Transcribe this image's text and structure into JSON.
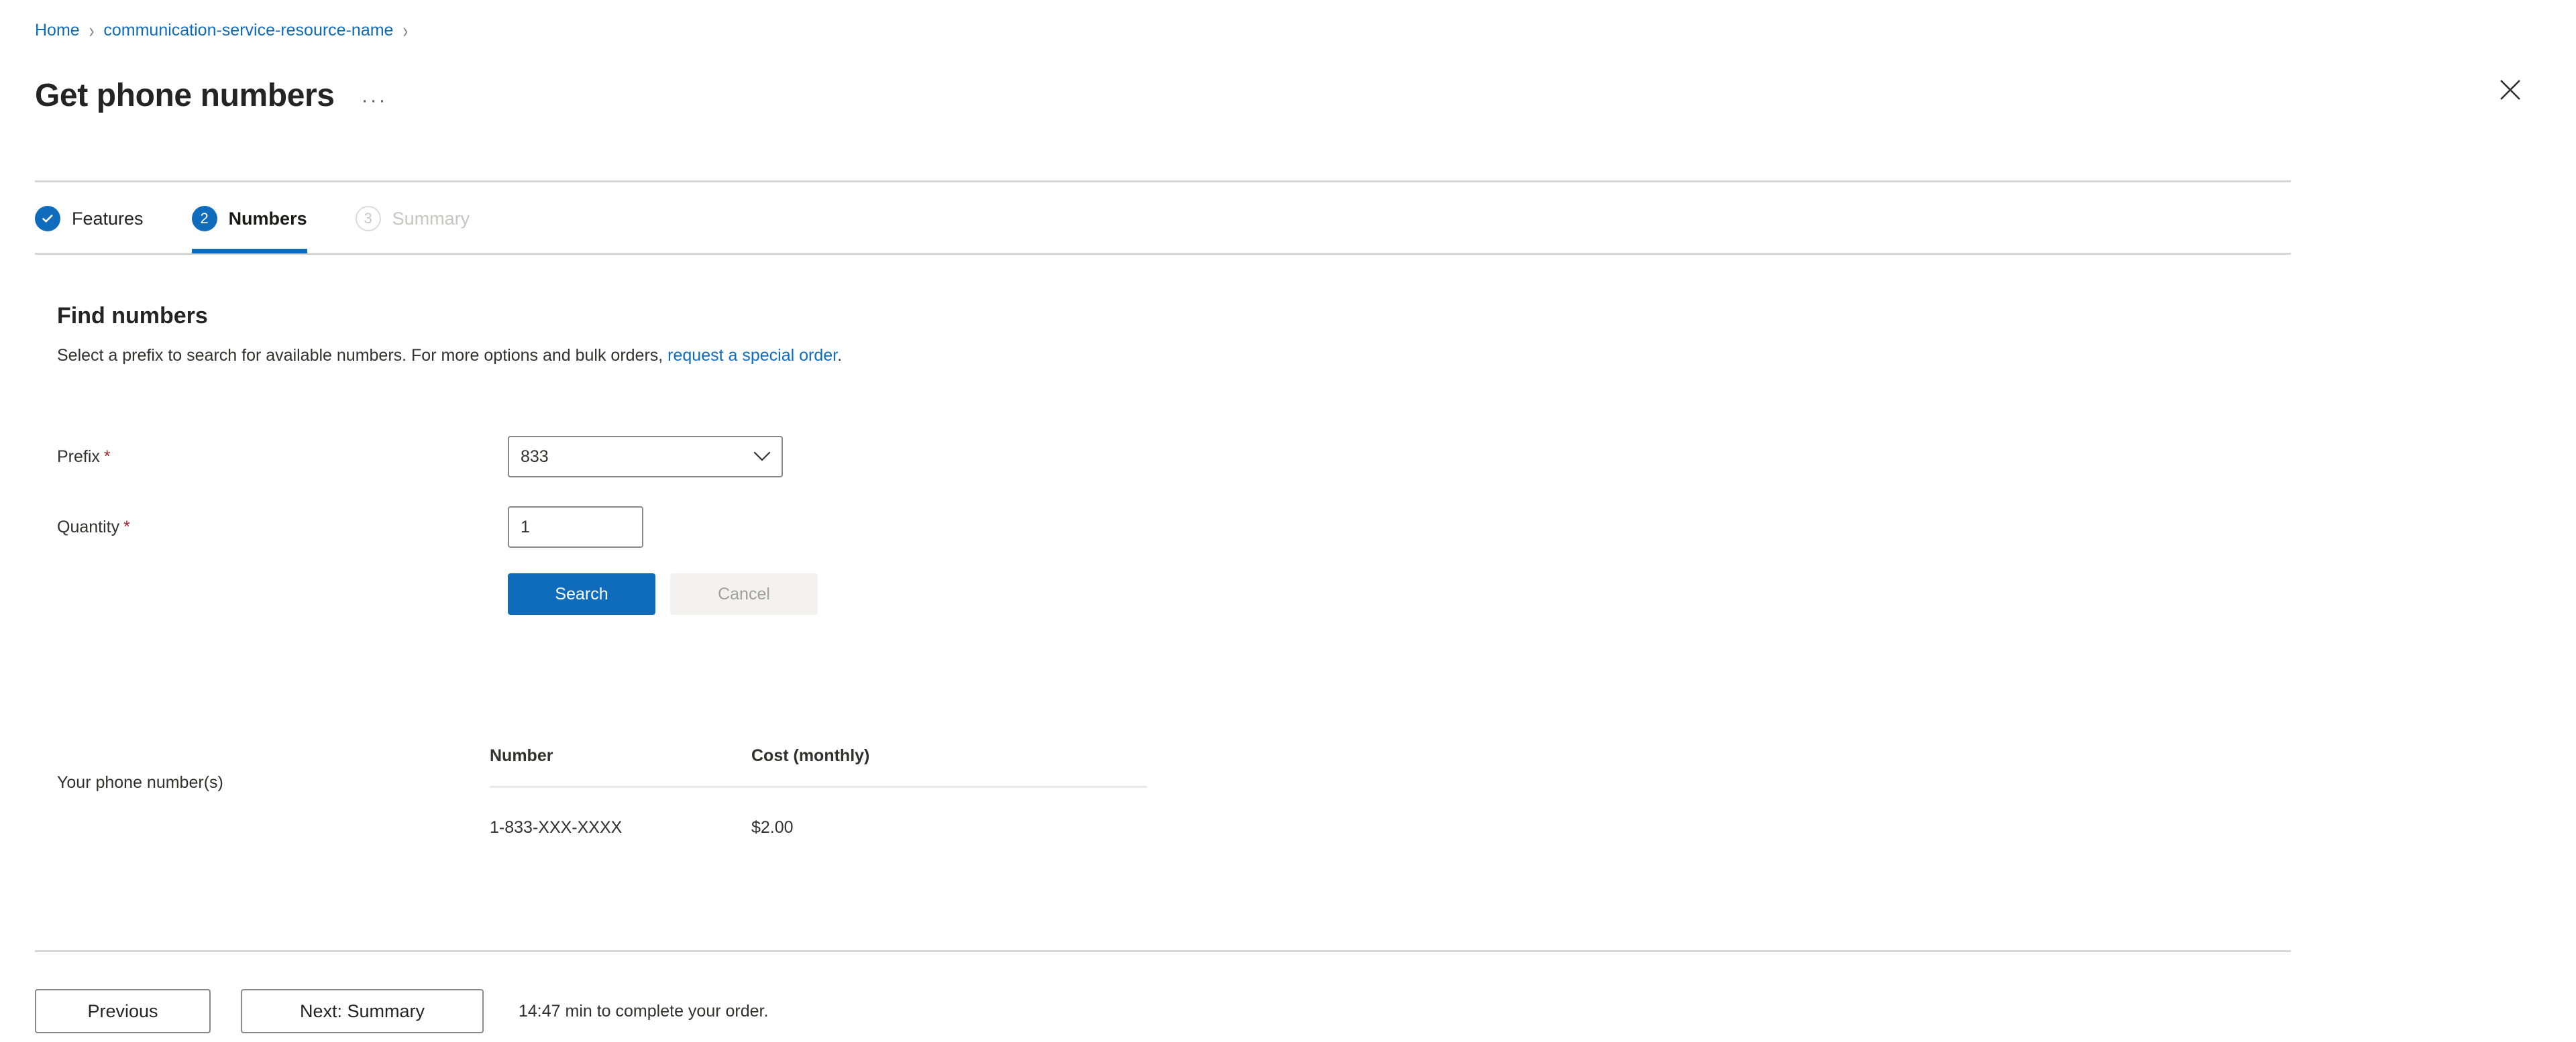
{
  "breadcrumb": {
    "items": [
      {
        "label": "Home"
      },
      {
        "label": "communication-service-resource-name"
      }
    ],
    "separator": "›"
  },
  "header": {
    "title": "Get phone numbers",
    "more_label": "···",
    "close_icon": "close-icon"
  },
  "tabs": [
    {
      "marker": "✓",
      "label": "Features",
      "state": "done"
    },
    {
      "marker": "2",
      "label": "Numbers",
      "state": "current"
    },
    {
      "marker": "3",
      "label": "Summary",
      "state": "upcoming"
    }
  ],
  "main": {
    "heading": "Find numbers",
    "subtext_before": "Select a prefix to search for available numbers. For more options and bulk orders, ",
    "subtext_link": "request a special order",
    "subtext_after": "."
  },
  "form": {
    "prefix": {
      "label": "Prefix",
      "required_marker": "*",
      "value": "833",
      "caret_icon": "chevron-down-icon"
    },
    "quantity": {
      "label": "Quantity",
      "required_marker": "*",
      "value": "1",
      "placeholder": ""
    },
    "search_label": "Search",
    "cancel_label": "Cancel"
  },
  "results": {
    "label": "Your phone number(s)",
    "columns": [
      "Number",
      "Cost (monthly)"
    ],
    "rows": [
      {
        "number": "1-833-XXX-XXXX",
        "cost": "$2.00"
      }
    ]
  },
  "footer": {
    "previous_label": "Previous",
    "next_label": "Next: Summary",
    "status": "14:47 min to complete your order."
  },
  "colors": {
    "accent": "#0f6cbd",
    "link": "#0f6cbd",
    "required": "#a4262c",
    "text": "#323130",
    "disabled_text": "#a19f9d",
    "rule": "#d6d6d6"
  }
}
